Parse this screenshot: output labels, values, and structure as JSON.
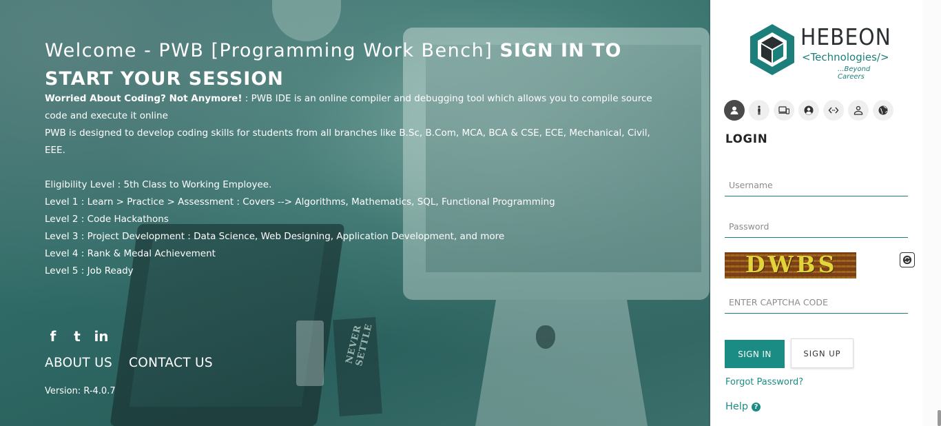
{
  "hero": {
    "welcome_light": "Welcome - PWB [Programming Work Bench]",
    "welcome_strong": "SIGN IN TO START YOUR SESSION",
    "intro_bold": "Worried About Coding? Not Anymore!",
    "intro_rest": " : PWB IDE is an online compiler and debugging tool which allows you to compile source code and execute it online",
    "branches": "PWB is designed to develop coding skills for students from all branches like B.Sc, B.Com, MCA, BCA & CSE, ECE, Mechanical, Civil, EEE.",
    "eligibility": "Eligibility Level : 5th Class to Working Employee.",
    "levels": [
      "Level 1 : Learn > Practice > Assessment : Covers --> Algorithms, Mathematics, SQL, Functional Programming",
      "Level 2 : Code Hackathons",
      "Level 3 : Project Development : Data Science, Web Designing, Application Development, and more",
      "Level 4 : Rank & Medal Achievement",
      "Level 5 : Job Ready"
    ],
    "social": [
      "facebook-icon",
      "twitter-icon",
      "linkedin-icon"
    ],
    "social_glyphs": {
      "facebook": "f",
      "twitter": "t",
      "linkedin": "in"
    },
    "about": "ABOUT US",
    "contact": "CONTACT US",
    "version": "Version: R-4.0.7",
    "card_text": "NEVER SETTLE"
  },
  "logo": {
    "name": "HEBEON",
    "technologies": "<Technologies/>",
    "tagline": "...Beyond Careers"
  },
  "login": {
    "title": "LOGIN",
    "roles": [
      "user-icon",
      "person-standing-icon",
      "devices-icon",
      "account-circle-icon",
      "code-icon",
      "person-outline-icon",
      "globe-icon"
    ],
    "username_placeholder": "Username",
    "password_placeholder": "Password",
    "captcha_text": "DWBS",
    "captcha_placeholder": "ENTER CAPTCHA CODE",
    "signin": "SIGN IN",
    "signup": "SIGN UP",
    "forgot": "Forgot Password?",
    "help": "Help",
    "help_icon": "?"
  },
  "colors": {
    "accent": "#1b8c83",
    "hero_overlay": "#2d6b68",
    "active_role": "#4a4a4a"
  }
}
